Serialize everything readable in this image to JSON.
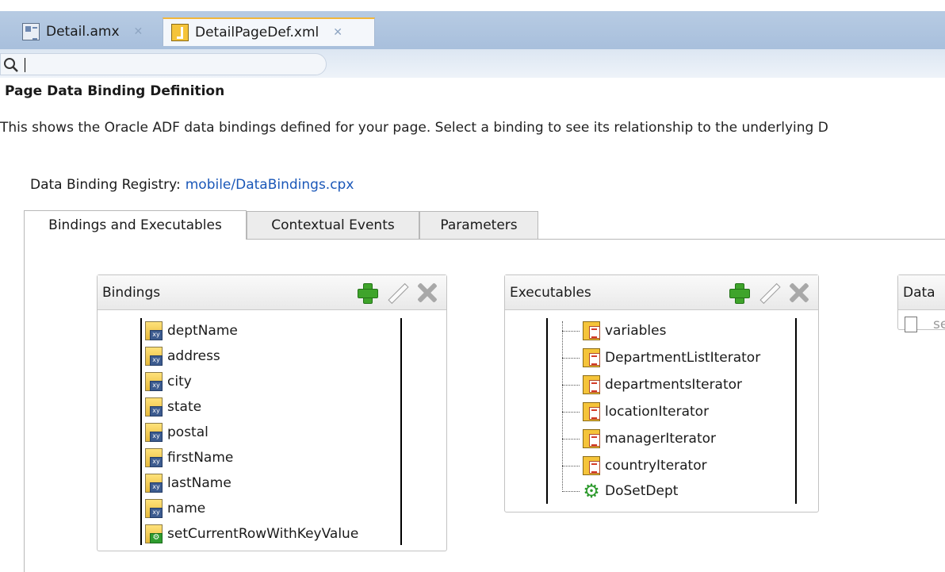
{
  "editor_tabs": [
    {
      "label": "Detail.amx",
      "icon": "amx-file-icon",
      "active": false
    },
    {
      "label": "DetailPageDef.xml",
      "icon": "xml-file-icon",
      "active": true
    }
  ],
  "search": {
    "value": "",
    "placeholder": ""
  },
  "page": {
    "title": "Page Data Binding Definition",
    "description": "This shows the Oracle ADF data bindings defined for your page. Select a binding to see its relationship to the underlying D",
    "registry_label": "Data Binding Registry:",
    "registry_link": "mobile/DataBindings.cpx"
  },
  "bottom_tabs": [
    "Bindings and Executables",
    "Contextual Events",
    "Parameters"
  ],
  "bindings_panel": {
    "title": "Bindings",
    "items": [
      {
        "label": "deptName",
        "icon": "attribute-binding-icon"
      },
      {
        "label": "address",
        "icon": "attribute-binding-icon"
      },
      {
        "label": "city",
        "icon": "attribute-binding-icon"
      },
      {
        "label": "state",
        "icon": "attribute-binding-icon"
      },
      {
        "label": "postal",
        "icon": "attribute-binding-icon"
      },
      {
        "label": "firstName",
        "icon": "attribute-binding-icon"
      },
      {
        "label": "lastName",
        "icon": "attribute-binding-icon"
      },
      {
        "label": "name",
        "icon": "attribute-binding-icon"
      },
      {
        "label": "setCurrentRowWithKeyValue",
        "icon": "action-binding-icon"
      }
    ]
  },
  "executables_panel": {
    "title": "Executables",
    "items": [
      {
        "label": "variables",
        "icon": "iterator-icon"
      },
      {
        "label": "DepartmentListIterator",
        "icon": "iterator-icon"
      },
      {
        "label": "departmentsIterator",
        "icon": "iterator-icon"
      },
      {
        "label": "locationIterator",
        "icon": "iterator-icon"
      },
      {
        "label": "managerIterator",
        "icon": "iterator-icon"
      },
      {
        "label": "countryIterator",
        "icon": "iterator-icon"
      },
      {
        "label": "DoSetDept",
        "icon": "gear-icon"
      }
    ]
  },
  "data_panel": {
    "title": "Data",
    "item": "se"
  },
  "colors": {
    "tab_bar": "#b7cbe3",
    "link": "#1a57b8",
    "add_green": "#3fa42b",
    "active_tab_accent": "#f2b63a"
  }
}
